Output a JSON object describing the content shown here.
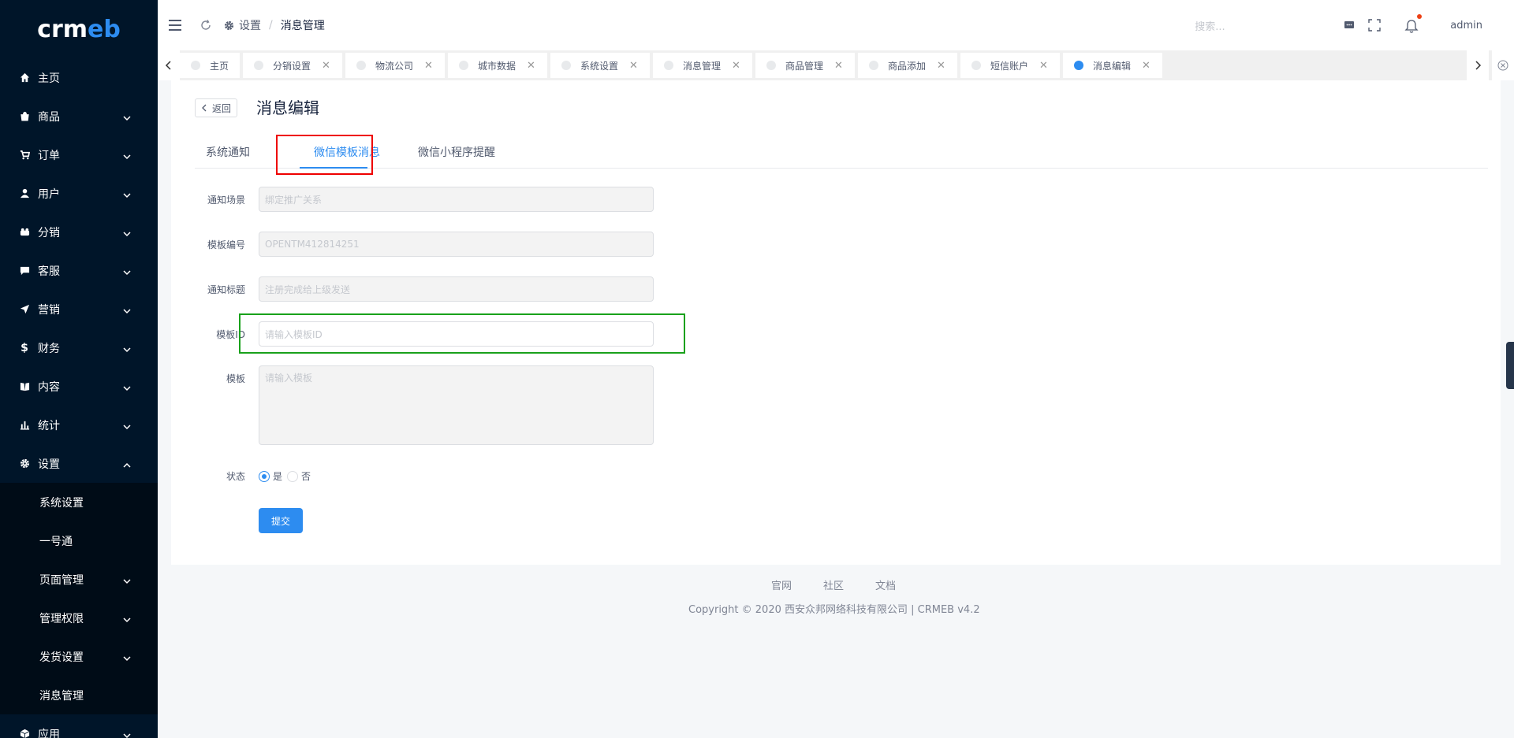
{
  "app": {
    "logo_left": "crm",
    "logo_right": "eb"
  },
  "sidebar": {
    "items": [
      {
        "label": "主页",
        "icon": "home-icon"
      },
      {
        "label": "商品",
        "icon": "shopping-bag-icon"
      },
      {
        "label": "订单",
        "icon": "cart-icon"
      },
      {
        "label": "用户",
        "icon": "user-icon"
      },
      {
        "label": "分销",
        "icon": "distribution-icon"
      },
      {
        "label": "客服",
        "icon": "chat-icon"
      },
      {
        "label": "营销",
        "icon": "send-icon"
      },
      {
        "label": "财务",
        "icon": "dollar-icon"
      },
      {
        "label": "内容",
        "icon": "book-icon"
      },
      {
        "label": "统计",
        "icon": "bar-chart-icon"
      },
      {
        "label": "设置",
        "icon": "gear-icon"
      }
    ],
    "settings_children": [
      {
        "label": "系统设置"
      },
      {
        "label": "一号通"
      },
      {
        "label": "页面管理"
      },
      {
        "label": "管理权限"
      },
      {
        "label": "发货设置"
      },
      {
        "label": "消息管理"
      }
    ],
    "app_item": {
      "label": "应用",
      "icon": "cube-icon"
    }
  },
  "header": {
    "breadcrumb": [
      "设置",
      "消息管理"
    ],
    "search_placeholder": "搜索...",
    "user": "admin"
  },
  "tabs": [
    {
      "label": "主页",
      "closable": false,
      "active": false
    },
    {
      "label": "分销设置",
      "closable": true,
      "active": false
    },
    {
      "label": "物流公司",
      "closable": true,
      "active": false
    },
    {
      "label": "城市数据",
      "closable": true,
      "active": false
    },
    {
      "label": "系统设置",
      "closable": true,
      "active": false
    },
    {
      "label": "消息管理",
      "closable": true,
      "active": false
    },
    {
      "label": "商品管理",
      "closable": true,
      "active": false
    },
    {
      "label": "商品添加",
      "closable": true,
      "active": false
    },
    {
      "label": "短信账户",
      "closable": true,
      "active": false
    },
    {
      "label": "消息编辑",
      "closable": true,
      "active": true
    }
  ],
  "page": {
    "back_label": "返回",
    "title": "消息编辑"
  },
  "form_tabs": [
    "系统通知",
    "微信模板消息",
    "微信小程序提醒"
  ],
  "form": {
    "scene_label": "通知场景",
    "scene_value": "绑定推广关系",
    "template_no_label": "模板编号",
    "template_no_value": "OPENTM412814251",
    "title_label": "通知标题",
    "title_value": "注册完成给上级发送",
    "template_id_label": "模板ID",
    "template_id_placeholder": "请输入模板ID",
    "template_label": "模板",
    "template_placeholder": "请输入模板",
    "status_label": "状态",
    "status_yes": "是",
    "status_no": "否",
    "status_value": "是",
    "submit_label": "提交"
  },
  "footer": {
    "links": [
      "官网",
      "社区",
      "文档"
    ],
    "copyright": "Copyright © 2020 西安众邦网络科技有限公司 | CRMEB v4.2"
  },
  "colors": {
    "primary": "#2d8cf0",
    "sidebar": "#001529",
    "highlight_red": "#e00000",
    "highlight_green": "#19a11b"
  }
}
